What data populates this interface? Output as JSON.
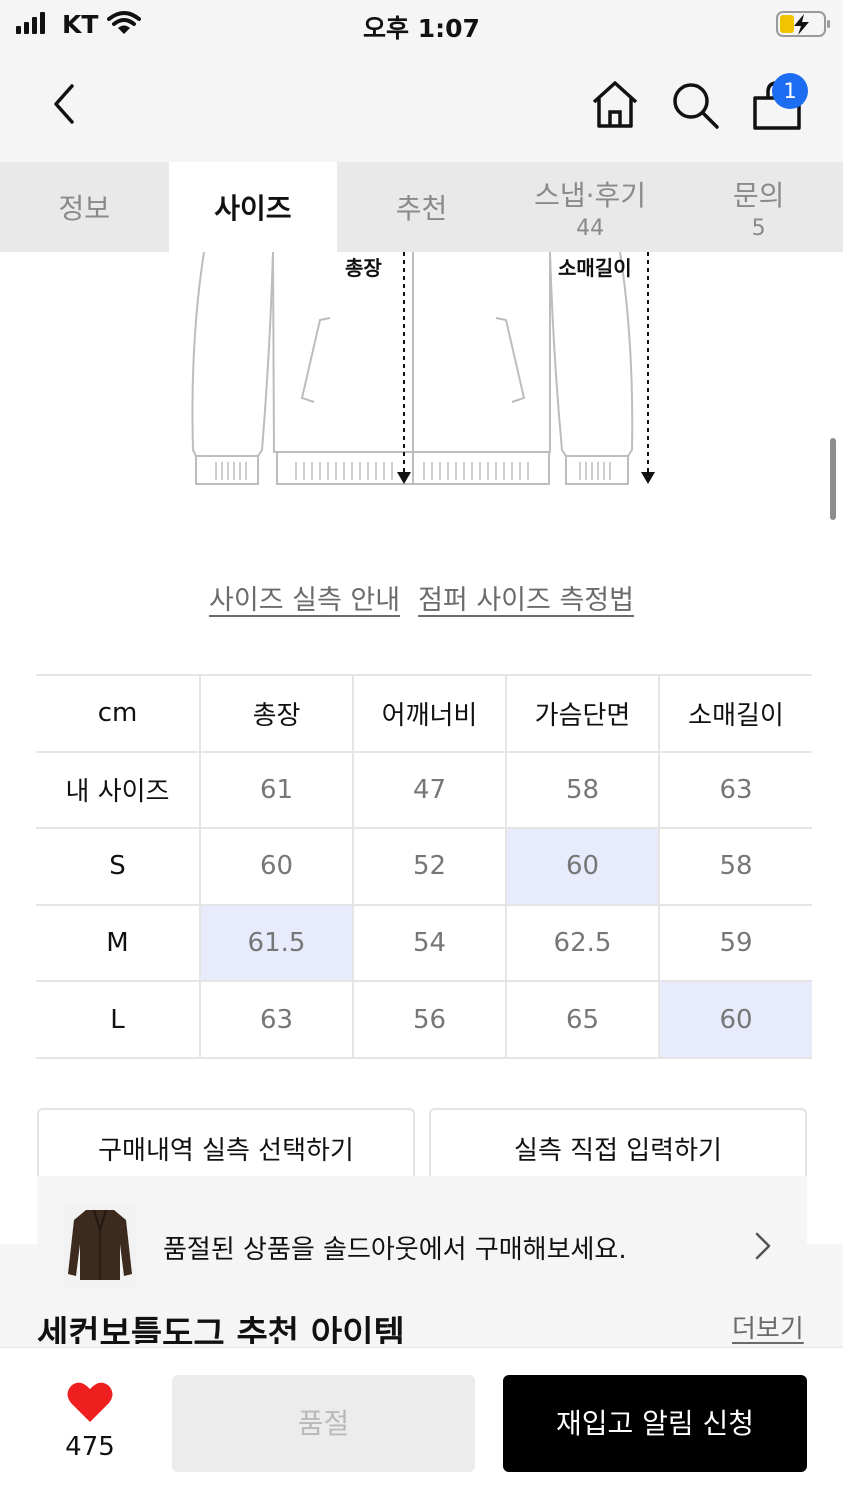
{
  "status_bar": {
    "carrier": "KT",
    "time": "오후 1:07"
  },
  "nav": {
    "bag_count": "1"
  },
  "tabs": [
    {
      "label": "정보",
      "count": ""
    },
    {
      "label": "사이즈",
      "count": ""
    },
    {
      "label": "추천",
      "count": ""
    },
    {
      "label": "스냅·후기",
      "count": "44"
    },
    {
      "label": "문의",
      "count": "5"
    }
  ],
  "active_tab": "사이즈",
  "illustration": {
    "label_length": "총장",
    "label_sleeve": "소매길이"
  },
  "guides": {
    "measure_guide": "사이즈 실측 안내",
    "jumper_method": "점퍼 사이즈 측정법"
  },
  "size_table": {
    "headers": [
      "cm",
      "총장",
      "어깨너비",
      "가슴단면",
      "소매길이"
    ],
    "rows": [
      {
        "label": "내 사이즈",
        "values": [
          "61",
          "47",
          "58",
          "63"
        ]
      },
      {
        "label": "S",
        "values": [
          "60",
          "52",
          "60",
          "58"
        ]
      },
      {
        "label": "M",
        "values": [
          "61.5",
          "54",
          "62.5",
          "59"
        ]
      },
      {
        "label": "L",
        "values": [
          "63",
          "56",
          "65",
          "60"
        ]
      }
    ],
    "highlight_color": "#e7ebfb"
  },
  "actions": {
    "select_from_purchases": "구매내역 실측 선택하기",
    "enter_directly": "실측 직접 입력하기"
  },
  "soldout_banner": {
    "text": "품절된 상품을 솔드아웃에서 구매해보세요."
  },
  "section": {
    "title": "세컨보틀도그 추천 아이템",
    "more": "더보기"
  },
  "bottom_bar": {
    "likes": "475",
    "soldout_label": "품절",
    "restock_label": "재입고 알림 신청",
    "heart_color": "#ef1f1f"
  }
}
